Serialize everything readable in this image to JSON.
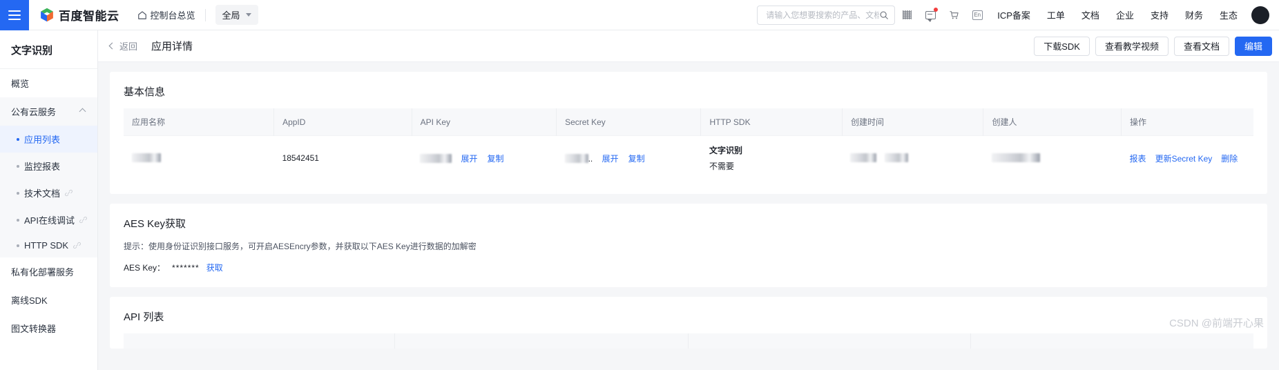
{
  "topbar": {
    "menu_icon": "hamburger-icon",
    "brand": "百度智能云",
    "console_link": "控制台总览",
    "scope": "全局",
    "search": {
      "placeholder": "请输入您想要搜索的产品、文档",
      "value": ""
    },
    "icons": [
      "qr-code-icon",
      "message-icon",
      "cart-icon",
      "language-en-icon"
    ],
    "nav_items": [
      {
        "label": "ICP备案"
      },
      {
        "label": "工单"
      },
      {
        "label": "文档"
      },
      {
        "label": "企业"
      },
      {
        "label": "支持"
      },
      {
        "label": "财务"
      },
      {
        "label": "生态"
      }
    ],
    "avatar": "user-avatar"
  },
  "sidebar": {
    "title": "文字识别",
    "overview": "概览",
    "group": {
      "label": "公有云服务",
      "items": [
        {
          "label": "应用列表",
          "external": false,
          "active": true
        },
        {
          "label": "监控报表",
          "external": false,
          "active": false
        },
        {
          "label": "技术文档",
          "external": true,
          "active": false
        },
        {
          "label": "API在线调试",
          "external": true,
          "active": false
        },
        {
          "label": "HTTP SDK",
          "external": true,
          "active": false
        }
      ]
    },
    "standalone": [
      {
        "label": "私有化部署服务"
      },
      {
        "label": "离线SDK"
      },
      {
        "label": "图文转换器"
      }
    ]
  },
  "page_head": {
    "back_label": "返回",
    "title": "应用详情",
    "buttons": [
      {
        "label": "下载SDK",
        "primary": false
      },
      {
        "label": "查看教学视频",
        "primary": false
      },
      {
        "label": "查看文档",
        "primary": false
      },
      {
        "label": "编辑",
        "primary": true
      }
    ]
  },
  "basic_info": {
    "title": "基本信息",
    "columns": [
      "应用名称",
      "AppID",
      "API Key",
      "Secret Key",
      "HTTP SDK",
      "创建时间",
      "创建人",
      "操作"
    ],
    "row": {
      "app_name": "",
      "app_id": "18542451",
      "api_key": "",
      "api_key_links": [
        "展开",
        "复制"
      ],
      "secret_key": "",
      "secret_key_suffix": "..",
      "secret_key_links": [
        "展开",
        "复制"
      ],
      "http_sdk_name": "文字识别",
      "http_sdk_status": "不需要",
      "create_time": "",
      "creator": "",
      "operations": [
        "报表",
        "更新Secret Key",
        "删除"
      ]
    }
  },
  "aes_section": {
    "title": "AES Key获取",
    "hint": "提示：使用身份证识别接口服务，可开启AESEncry参数，并获取以下AES Key进行数据的加解密",
    "key_label": "AES Key：",
    "key_value": "*******",
    "get_link": "获取"
  },
  "api_list": {
    "title": "API 列表"
  },
  "watermark": "CSDN @前端开心果",
  "colors": {
    "accent": "#2468f2",
    "badge": "#f33e3e",
    "page_bg": "#f5f6f8",
    "header_bg": "#f7f8fa"
  }
}
